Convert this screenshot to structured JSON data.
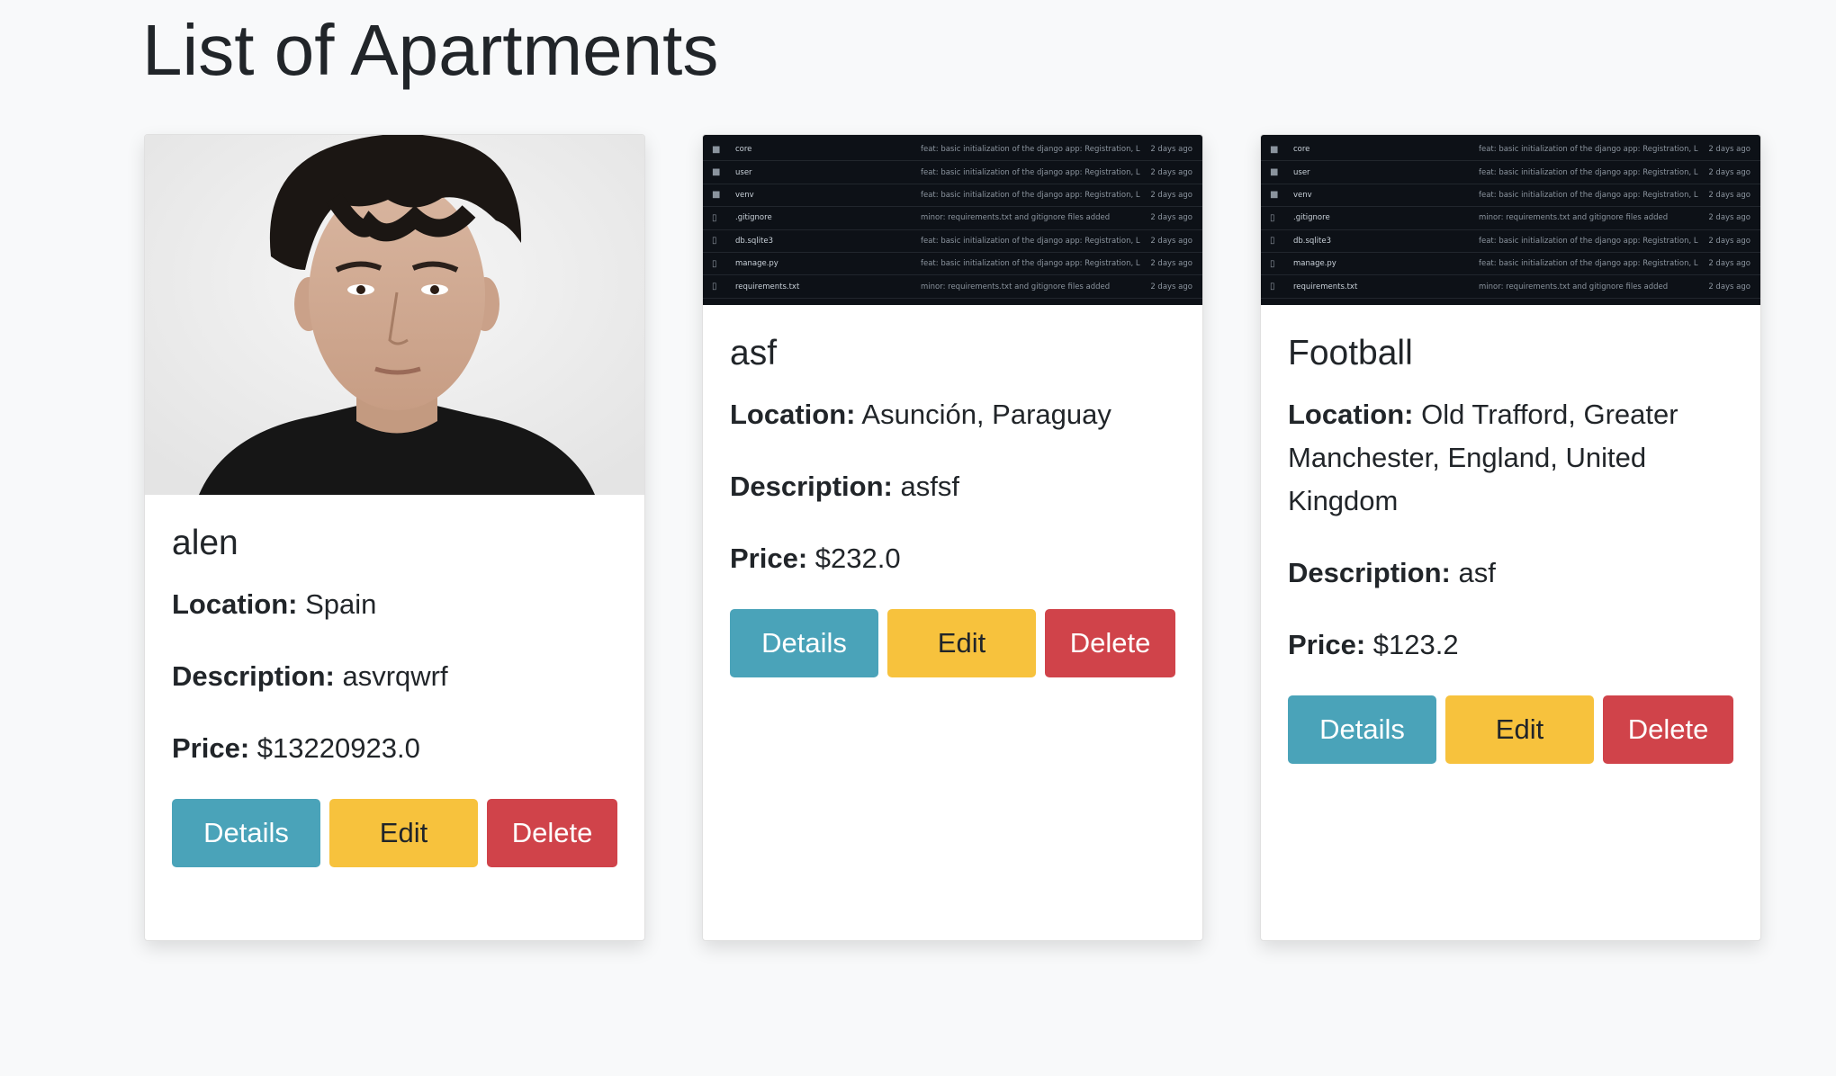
{
  "page": {
    "title": "List of Apartments"
  },
  "colors": {
    "details": "#4aa3b9",
    "edit": "#f7c23d",
    "delete": "#d0434a",
    "background": "#f8f9fa"
  },
  "labels": {
    "location": "Location:",
    "description": "Description:",
    "price": "Price:"
  },
  "buttons": {
    "details": "Details",
    "edit": "Edit",
    "delete": "Delete"
  },
  "repo_rows": [
    {
      "icon": "folder-icon",
      "name": "core",
      "message": "feat: basic initialization of the django app: Registration, Lo...",
      "when": "2 days ago"
    },
    {
      "icon": "folder-icon",
      "name": "user",
      "message": "feat: basic initialization of the django app: Registration, Lo...",
      "when": "2 days ago"
    },
    {
      "icon": "folder-icon",
      "name": "venv",
      "message": "feat: basic initialization of the django app: Registration, Lo...",
      "when": "2 days ago"
    },
    {
      "icon": "file-icon",
      "name": ".gitignore",
      "message": "minor: requirements.txt and gitignore files added",
      "when": "2 days ago"
    },
    {
      "icon": "file-icon",
      "name": "db.sqlite3",
      "message": "feat: basic initialization of the django app: Registration, Lo...",
      "when": "2 days ago"
    },
    {
      "icon": "file-icon",
      "name": "manage.py",
      "message": "feat: basic initialization of the django app: Registration, Lo...",
      "when": "2 days ago"
    },
    {
      "icon": "file-icon",
      "name": "requirements.txt",
      "message": "minor: requirements.txt and gitignore files added",
      "when": "2 days ago"
    }
  ],
  "apartments": [
    {
      "name": "alen",
      "location": "Spain",
      "description": "asvrqwrf",
      "price": "$13220923.0",
      "image": "portrait-photo"
    },
    {
      "name": "asf",
      "location": "Asunción, Paraguay",
      "description": "asfsf",
      "price": "$232.0",
      "image": "repository-screenshot"
    },
    {
      "name": "Football",
      "location": "Old Trafford, Greater Manchester, England, United Kingdom",
      "description": "asf",
      "price": "$123.2",
      "image": "repository-screenshot"
    }
  ]
}
